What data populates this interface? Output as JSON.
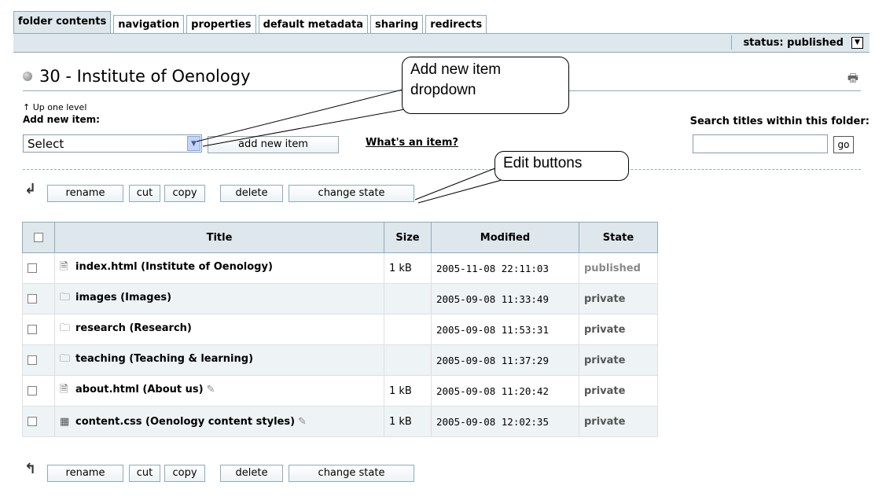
{
  "tabs": [
    "folder contents",
    "navigation",
    "properties",
    "default metadata",
    "sharing",
    "redirects"
  ],
  "status": {
    "label": "status: published"
  },
  "page": {
    "title": "30 - Institute of Oenology",
    "up_one_level": "Up one level",
    "add_new_label": "Add new item:"
  },
  "add_item": {
    "select_value": "Select",
    "button": "add new item",
    "whats_link": "What's an item?"
  },
  "search": {
    "label": "Search titles within this folder:",
    "go": "go",
    "value": ""
  },
  "edit_buttons": {
    "rename": "rename",
    "cut": "cut",
    "copy": "copy",
    "delete": "delete",
    "change_state": "change state"
  },
  "table": {
    "headers": [
      "Title",
      "Size",
      "Modified",
      "State"
    ],
    "rows": [
      {
        "icon": "document-icon",
        "title": "index.html (Institute of Oenology)",
        "size": "1 kB",
        "modified": "2005-11-08 22:11:03",
        "state": "published",
        "editable": false
      },
      {
        "icon": "folder-icon",
        "title": "images (Images)",
        "size": "",
        "modified": "2005-09-08 11:33:49",
        "state": "private",
        "editable": false
      },
      {
        "icon": "folder-icon",
        "title": "research (Research)",
        "size": "",
        "modified": "2005-09-08 11:53:31",
        "state": "private",
        "editable": false
      },
      {
        "icon": "folder-icon",
        "title": "teaching (Teaching & learning)",
        "size": "",
        "modified": "2005-09-08 11:37:29",
        "state": "private",
        "editable": false
      },
      {
        "icon": "document-icon",
        "title": "about.html (About us)",
        "size": "1 kB",
        "modified": "2005-09-08 11:20:42",
        "state": "private",
        "editable": true
      },
      {
        "icon": "stylesheet-icon",
        "title": "content.css (Oenology content styles)",
        "size": "1 kB",
        "modified": "2005-09-08 12:02:35",
        "state": "private",
        "editable": true
      }
    ]
  },
  "callouts": {
    "add_new": "Add new item\ndropdown",
    "edit": "Edit buttons"
  }
}
